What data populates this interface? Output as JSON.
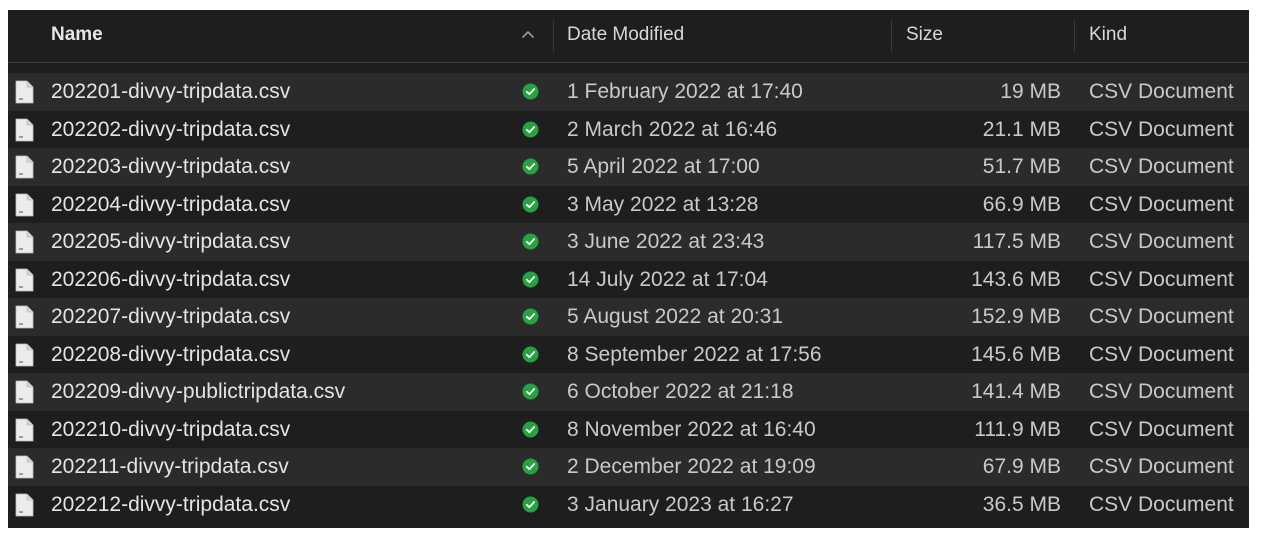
{
  "header": {
    "name_label": "Name",
    "date_label": "Date Modified",
    "size_label": "Size",
    "kind_label": "Kind",
    "sort_icon": "chevron-up-icon"
  },
  "colors": {
    "background": "#1e1e1e",
    "row_alt": "#2b2b2b",
    "status_green": "#27a243"
  },
  "files": [
    {
      "name": "202201-divvy-tripdata.csv",
      "date": "1 February 2022 at 17:40",
      "size": "19 MB",
      "kind": "CSV Document"
    },
    {
      "name": "202202-divvy-tripdata.csv",
      "date": "2 March 2022 at 16:46",
      "size": "21.1 MB",
      "kind": "CSV Document"
    },
    {
      "name": "202203-divvy-tripdata.csv",
      "date": "5 April 2022 at 17:00",
      "size": "51.7 MB",
      "kind": "CSV Document"
    },
    {
      "name": "202204-divvy-tripdata.csv",
      "date": "3 May 2022 at 13:28",
      "size": "66.9 MB",
      "kind": "CSV Document"
    },
    {
      "name": "202205-divvy-tripdata.csv",
      "date": "3 June 2022 at 23:43",
      "size": "117.5 MB",
      "kind": "CSV Document"
    },
    {
      "name": "202206-divvy-tripdata.csv",
      "date": "14 July 2022 at 17:04",
      "size": "143.6 MB",
      "kind": "CSV Document"
    },
    {
      "name": "202207-divvy-tripdata.csv",
      "date": "5 August 2022 at 20:31",
      "size": "152.9 MB",
      "kind": "CSV Document"
    },
    {
      "name": "202208-divvy-tripdata.csv",
      "date": "8 September 2022 at 17:56",
      "size": "145.6 MB",
      "kind": "CSV Document"
    },
    {
      "name": "202209-divvy-publictripdata.csv",
      "date": "6 October 2022 at 21:18",
      "size": "141.4 MB",
      "kind": "CSV Document"
    },
    {
      "name": "202210-divvy-tripdata.csv",
      "date": "8 November 2022 at 16:40",
      "size": "111.9 MB",
      "kind": "CSV Document"
    },
    {
      "name": "202211-divvy-tripdata.csv",
      "date": "2 December 2022 at 19:09",
      "size": "67.9 MB",
      "kind": "CSV Document"
    },
    {
      "name": "202212-divvy-tripdata.csv",
      "date": "3 January 2023 at 16:27",
      "size": "36.5 MB",
      "kind": "CSV Document"
    }
  ]
}
